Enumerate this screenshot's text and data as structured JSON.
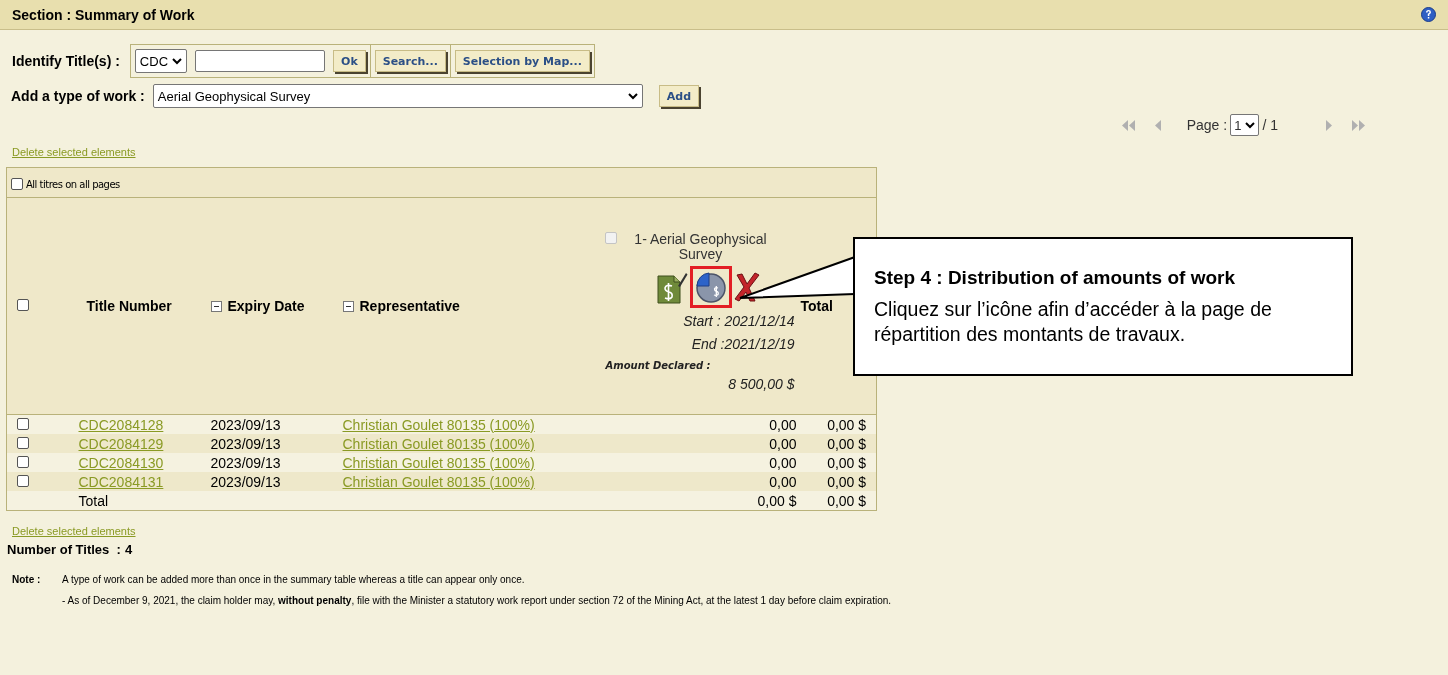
{
  "header": {
    "title": "Section : Summary of Work"
  },
  "identify": {
    "label": "Identify Title(s) :",
    "prefix": "CDC",
    "buttons": [
      "Ok",
      "Search...",
      "Selection by Map..."
    ]
  },
  "add_work": {
    "label": "Add a type of work :",
    "value": "Aerial Geophysical Survey",
    "button": "Add"
  },
  "pagination": {
    "label": "Page :",
    "page": "1",
    "total": "/ 1"
  },
  "delete_top": "Delete selected elements",
  "table": {
    "all_titles": {
      "label": "All titres on all pages",
      "checked": false
    },
    "header_checked": false,
    "columns": [
      {
        "label": "Title Number",
        "collapsible": false
      },
      {
        "label": "Expiry Date",
        "collapsible": true
      },
      {
        "label": "Representative",
        "collapsible": true
      }
    ],
    "work": {
      "label": "1- Aerial Geophysical Survey",
      "checked": false,
      "disabled": true,
      "start": "Start : 2021/12/14",
      "end": "End :2021/12/19",
      "amount_label": "Amount Declared :",
      "amount": "8 500,00 $"
    },
    "total_header": "Total",
    "rows": [
      {
        "checked": false,
        "title": "CDC2084128",
        "expiry": "2023/09/13",
        "representative": "Christian Goulet 80135 (100%)",
        "amount": "0,00",
        "total": "0,00 $"
      },
      {
        "checked": false,
        "title": "CDC2084129",
        "expiry": "2023/09/13",
        "representative": "Christian Goulet 80135 (100%)",
        "amount": "0,00",
        "total": "0,00 $"
      },
      {
        "checked": false,
        "title": "CDC2084130",
        "expiry": "2023/09/13",
        "representative": "Christian Goulet 80135 (100%)",
        "amount": "0,00",
        "total": "0,00 $"
      },
      {
        "checked": false,
        "title": "CDC2084131",
        "expiry": "2023/09/13",
        "representative": "Christian Goulet 80135 (100%)",
        "amount": "0,00",
        "total": "0,00 $"
      }
    ],
    "total_row": {
      "label": "Total",
      "amount": "0,00 $",
      "total": "0,00 $"
    }
  },
  "delete_bottom": "Delete selected elements",
  "count": {
    "label": "Number of Titles  :",
    "value": "4"
  },
  "note": {
    "label": "Note :",
    "lines": [
      "A type of work can be added more than once in the summary table whereas a title can appear only once.",
      "- As of December 9, 2021, the claim holder may, **without penalty**, file with the Minister a statutory work report under section 72 of the Mining Act, at the latest 1 day before claim expiration."
    ]
  },
  "callout": {
    "title": "Step 4 : Distribution of amounts of work",
    "text": "Cliquez sur l’icône afin d’accéder à la page de répartition des montants de travaux."
  }
}
